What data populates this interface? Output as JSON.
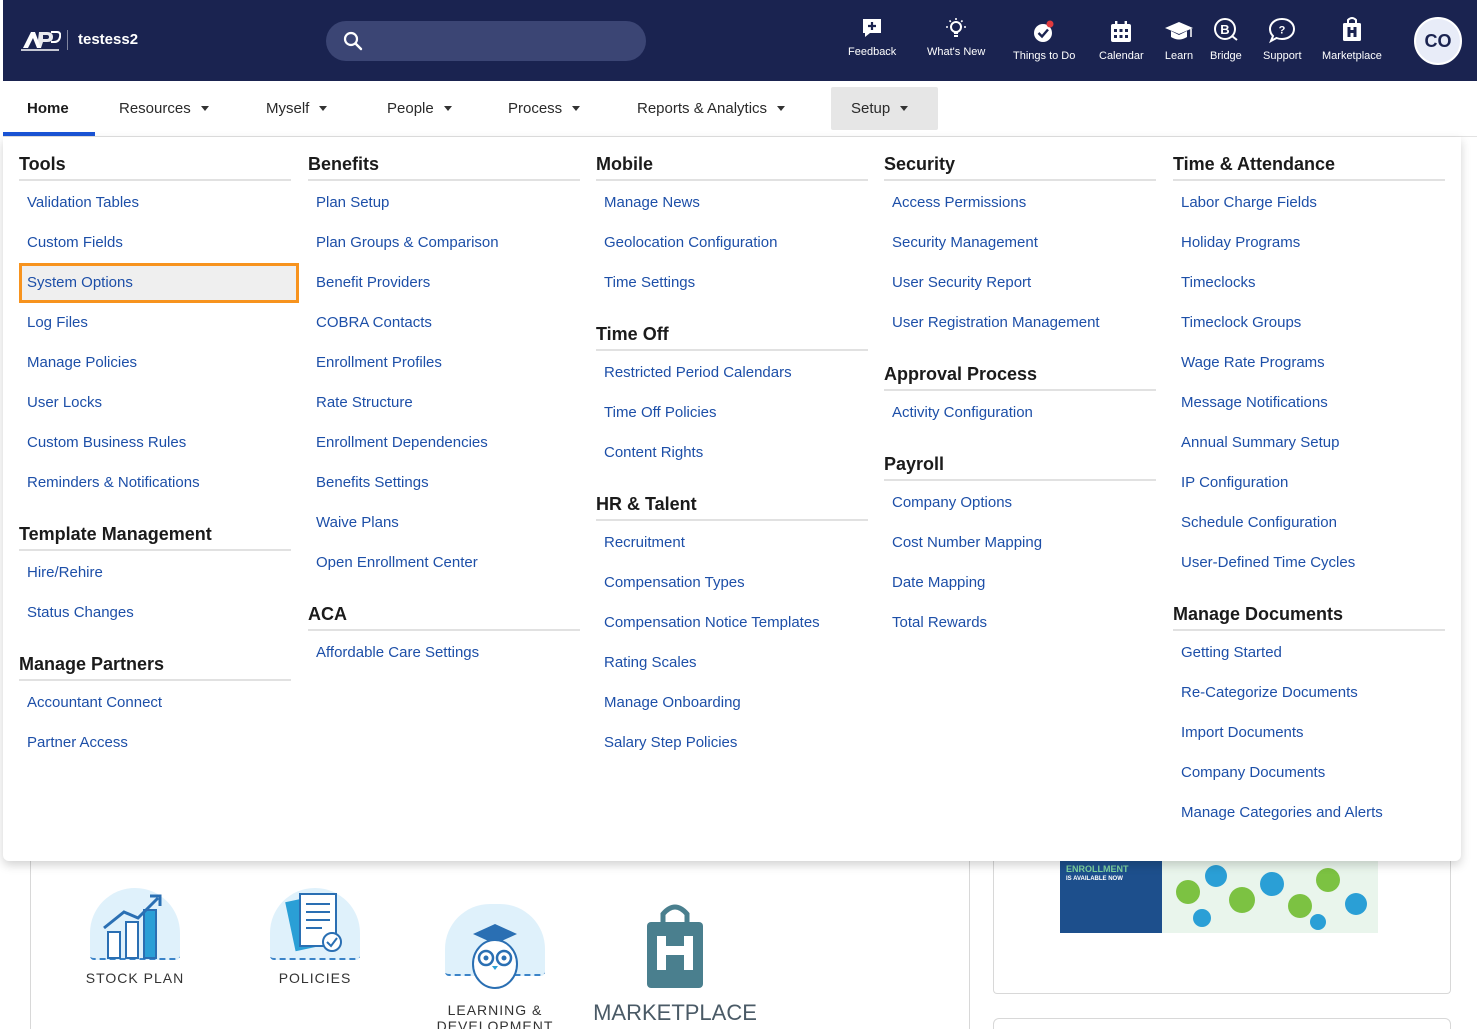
{
  "header": {
    "org_name": "testess2",
    "avatar_initials": "CO",
    "tools": [
      {
        "label": "Feedback",
        "icon": "feedback-icon"
      },
      {
        "label": "What's New",
        "icon": "lightbulb-icon"
      },
      {
        "label": "Things to Do",
        "icon": "checkmark-badge-icon"
      },
      {
        "label": "Calendar",
        "icon": "calendar-icon"
      },
      {
        "label": "Learn",
        "icon": "graduation-cap-icon"
      },
      {
        "label": "Bridge",
        "icon": "bridge-icon"
      },
      {
        "label": "Support",
        "icon": "chat-bubble-icon"
      },
      {
        "label": "Marketplace",
        "icon": "marketplace-bag-icon"
      }
    ]
  },
  "nav": {
    "items": [
      {
        "label": "Home"
      },
      {
        "label": "Resources"
      },
      {
        "label": "Myself"
      },
      {
        "label": "People"
      },
      {
        "label": "Process"
      },
      {
        "label": "Reports & Analytics"
      },
      {
        "label": "Setup"
      }
    ]
  },
  "menu": {
    "columns": [
      {
        "sections": [
          {
            "title": "Tools",
            "links": [
              "Validation Tables",
              "Custom Fields",
              "System Options",
              "Log Files",
              "Manage Policies",
              "User Locks",
              "Custom Business Rules",
              "Reminders & Notifications"
            ]
          },
          {
            "title": "Template Management",
            "links": [
              "Hire/Rehire",
              "Status Changes"
            ]
          },
          {
            "title": "Manage Partners",
            "links": [
              "Accountant Connect",
              "Partner Access"
            ]
          }
        ]
      },
      {
        "sections": [
          {
            "title": "Benefits",
            "links": [
              "Plan Setup",
              "Plan Groups & Comparison",
              "Benefit Providers",
              "COBRA Contacts",
              "Enrollment Profiles",
              "Rate Structure",
              "Enrollment Dependencies",
              "Benefits Settings",
              "Waive Plans",
              "Open Enrollment Center"
            ]
          },
          {
            "title": "ACA",
            "links": [
              "Affordable Care Settings"
            ]
          }
        ]
      },
      {
        "sections": [
          {
            "title": "Mobile",
            "links": [
              "Manage News",
              "Geolocation Configuration",
              "Time Settings"
            ]
          },
          {
            "title": "Time Off",
            "links": [
              "Restricted Period Calendars",
              "Time Off Policies",
              "Content Rights"
            ]
          },
          {
            "title": "HR & Talent",
            "links": [
              "Recruitment",
              "Compensation Types",
              "Compensation Notice Templates",
              "Rating Scales",
              "Manage Onboarding",
              "Salary Step Policies"
            ]
          }
        ]
      },
      {
        "sections": [
          {
            "title": "Security",
            "links": [
              "Access Permissions",
              "Security Management",
              "User Security Report",
              "User Registration Management"
            ]
          },
          {
            "title": "Approval Process",
            "links": [
              "Activity Configuration"
            ]
          },
          {
            "title": "Payroll",
            "links": [
              "Company Options",
              "Cost Number Mapping",
              "Date Mapping",
              "Total Rewards"
            ]
          }
        ]
      },
      {
        "sections": [
          {
            "title": "Time & Attendance",
            "links": [
              "Labor Charge Fields",
              "Holiday Programs",
              "Timeclocks",
              "Timeclock Groups",
              "Wage Rate Programs",
              "Message Notifications",
              "Annual Summary Setup",
              "IP Configuration",
              "Schedule Configuration",
              "User-Defined Time Cycles"
            ]
          },
          {
            "title": "Manage Documents",
            "links": [
              "Getting Started",
              "Re-Categorize Documents",
              "Import Documents",
              "Company Documents",
              "Manage Categories and Alerts"
            ]
          }
        ]
      }
    ],
    "highlighted_link": "System Options",
    "highlight_color": "#f7931e"
  },
  "background": {
    "tiles": [
      {
        "label": "STOCK PLAN"
      },
      {
        "label": "POLICIES"
      },
      {
        "label": "LEARNING &\nDEVELOPMENT"
      },
      {
        "label": "MARKETPLACE"
      }
    ],
    "banner": {
      "line1": "ENROLLMENT",
      "line2": "IS AVAILABLE NOW"
    }
  },
  "colors": {
    "header_bg": "#1a2350",
    "link": "#1d4fa8",
    "accent": "#1a54d6"
  }
}
